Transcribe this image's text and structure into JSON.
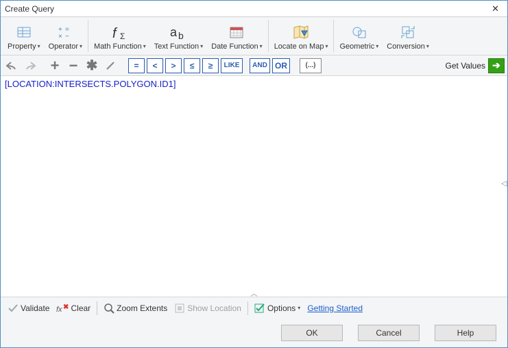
{
  "window": {
    "title": "Create Query"
  },
  "ribbon": {
    "property": "Property",
    "operator": "Operator",
    "math": "Math Function",
    "text": "Text Function",
    "date": "Date Function",
    "locate": "Locate on Map",
    "geometric": "Geometric",
    "conversion": "Conversion"
  },
  "toolbar2": {
    "ops": [
      "=",
      "<",
      ">",
      "≤",
      "≥",
      "LIKE",
      "AND",
      "OR",
      "(...)"
    ],
    "get_values": "Get Values"
  },
  "editor": {
    "content": "[LOCATION:INTERSECTS.POLYGON.ID1]"
  },
  "bottombar": {
    "validate": "Validate",
    "clear": "Clear",
    "zoom": "Zoom Extents",
    "showloc": "Show Location",
    "options": "Options",
    "getting_started": "Getting Started"
  },
  "footer": {
    "ok": "OK",
    "cancel": "Cancel",
    "help": "Help"
  }
}
